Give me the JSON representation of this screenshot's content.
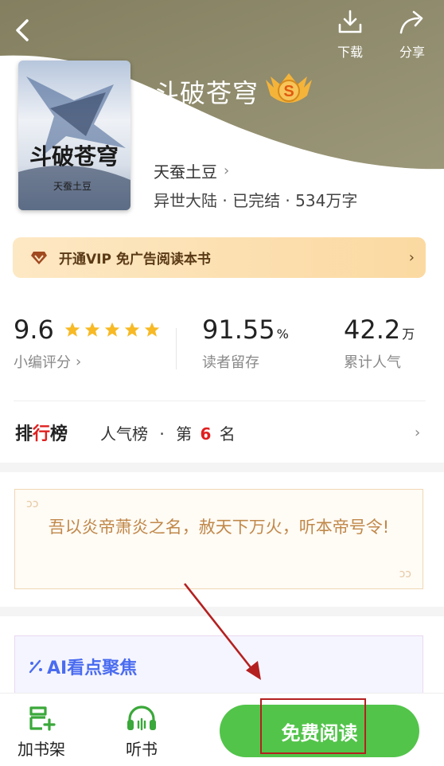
{
  "header": {
    "download_label": "下载",
    "share_label": "分享"
  },
  "book": {
    "title": "斗破苍穹",
    "badge_letter": "S",
    "author": "天蚕土豆",
    "meta": "异世大陆 · 已完结 · 534万字",
    "cover_title": "斗破苍穹",
    "cover_author": "天蚕土豆"
  },
  "vip": {
    "text": "开通VIP 免广告阅读本书"
  },
  "stats": {
    "score": "9.6",
    "stars": 5,
    "score_caption": "小编评分",
    "retention": "91.55",
    "retention_unit": "%",
    "retention_caption": "读者留存",
    "popularity": "42.2",
    "popularity_unit": "万",
    "popularity_caption": "累计人气"
  },
  "rank": {
    "logo_a": "排",
    "logo_b": "行",
    "logo_c": "榜",
    "list_name": "人气榜",
    "separator": "·",
    "prefix": "第",
    "position": "6",
    "suffix": "名"
  },
  "quote": {
    "text": "吾以炎帝萧炎之名，赦天下万火，听本帝号令!"
  },
  "ai": {
    "title": "AI看点聚焦"
  },
  "bottom": {
    "shelf_label": "加书架",
    "listen_label": "听书",
    "read_label": "免费阅读"
  },
  "colors": {
    "accent_green": "#52c44a",
    "header_olive": "#8e8a6a",
    "rank_red": "#e02020",
    "quote_text": "#c0884a",
    "ai_blue": "#4a6cf0",
    "annotation_red": "#b42020"
  }
}
